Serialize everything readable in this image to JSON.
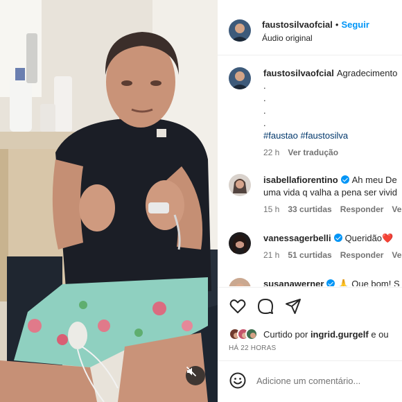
{
  "post": {
    "username": "faustosilvaofcial",
    "follow_label": "Seguir",
    "audio_label": "Áudio original",
    "mute_icon": "speaker-muted-icon"
  },
  "caption": {
    "username": "faustosilvaofcial",
    "text": "Agradecimento",
    "dots": [
      ".",
      ".",
      ".",
      "."
    ],
    "hashtags": "#faustao #faustosilva",
    "time": "22 h",
    "translate_label": "Ver tradução"
  },
  "comments": [
    {
      "username": "isabellafiorentino",
      "verified": true,
      "text_line1": "Ah meu De",
      "text_line2": "uma vida q valha a pena ser vivid",
      "time": "15 h",
      "likes": "33 curtidas",
      "reply_label": "Responder",
      "more_label": "Ver"
    },
    {
      "username": "vanessagerbelli",
      "verified": true,
      "text": "Queridão",
      "emoji": "❤️",
      "time": "21 h",
      "likes": "51 curtidas",
      "reply_label": "Responder",
      "more_label": "Ver"
    },
    {
      "username": "susanawerner",
      "verified": true,
      "emoji": "🙏",
      "text": "Que bom! S"
    }
  ],
  "actions": {
    "like_icon": "heart-icon",
    "comment_icon": "comment-icon",
    "share_icon": "share-icon",
    "liked_by_prefix": "Curtido por",
    "liked_by_user": "ingrid.gurgelf",
    "liked_by_suffix": "e ou",
    "time_ago": "HÁ 22 HORAS"
  },
  "composer": {
    "emoji_icon": "smiley-icon",
    "placeholder": "Adicione um comentário..."
  }
}
